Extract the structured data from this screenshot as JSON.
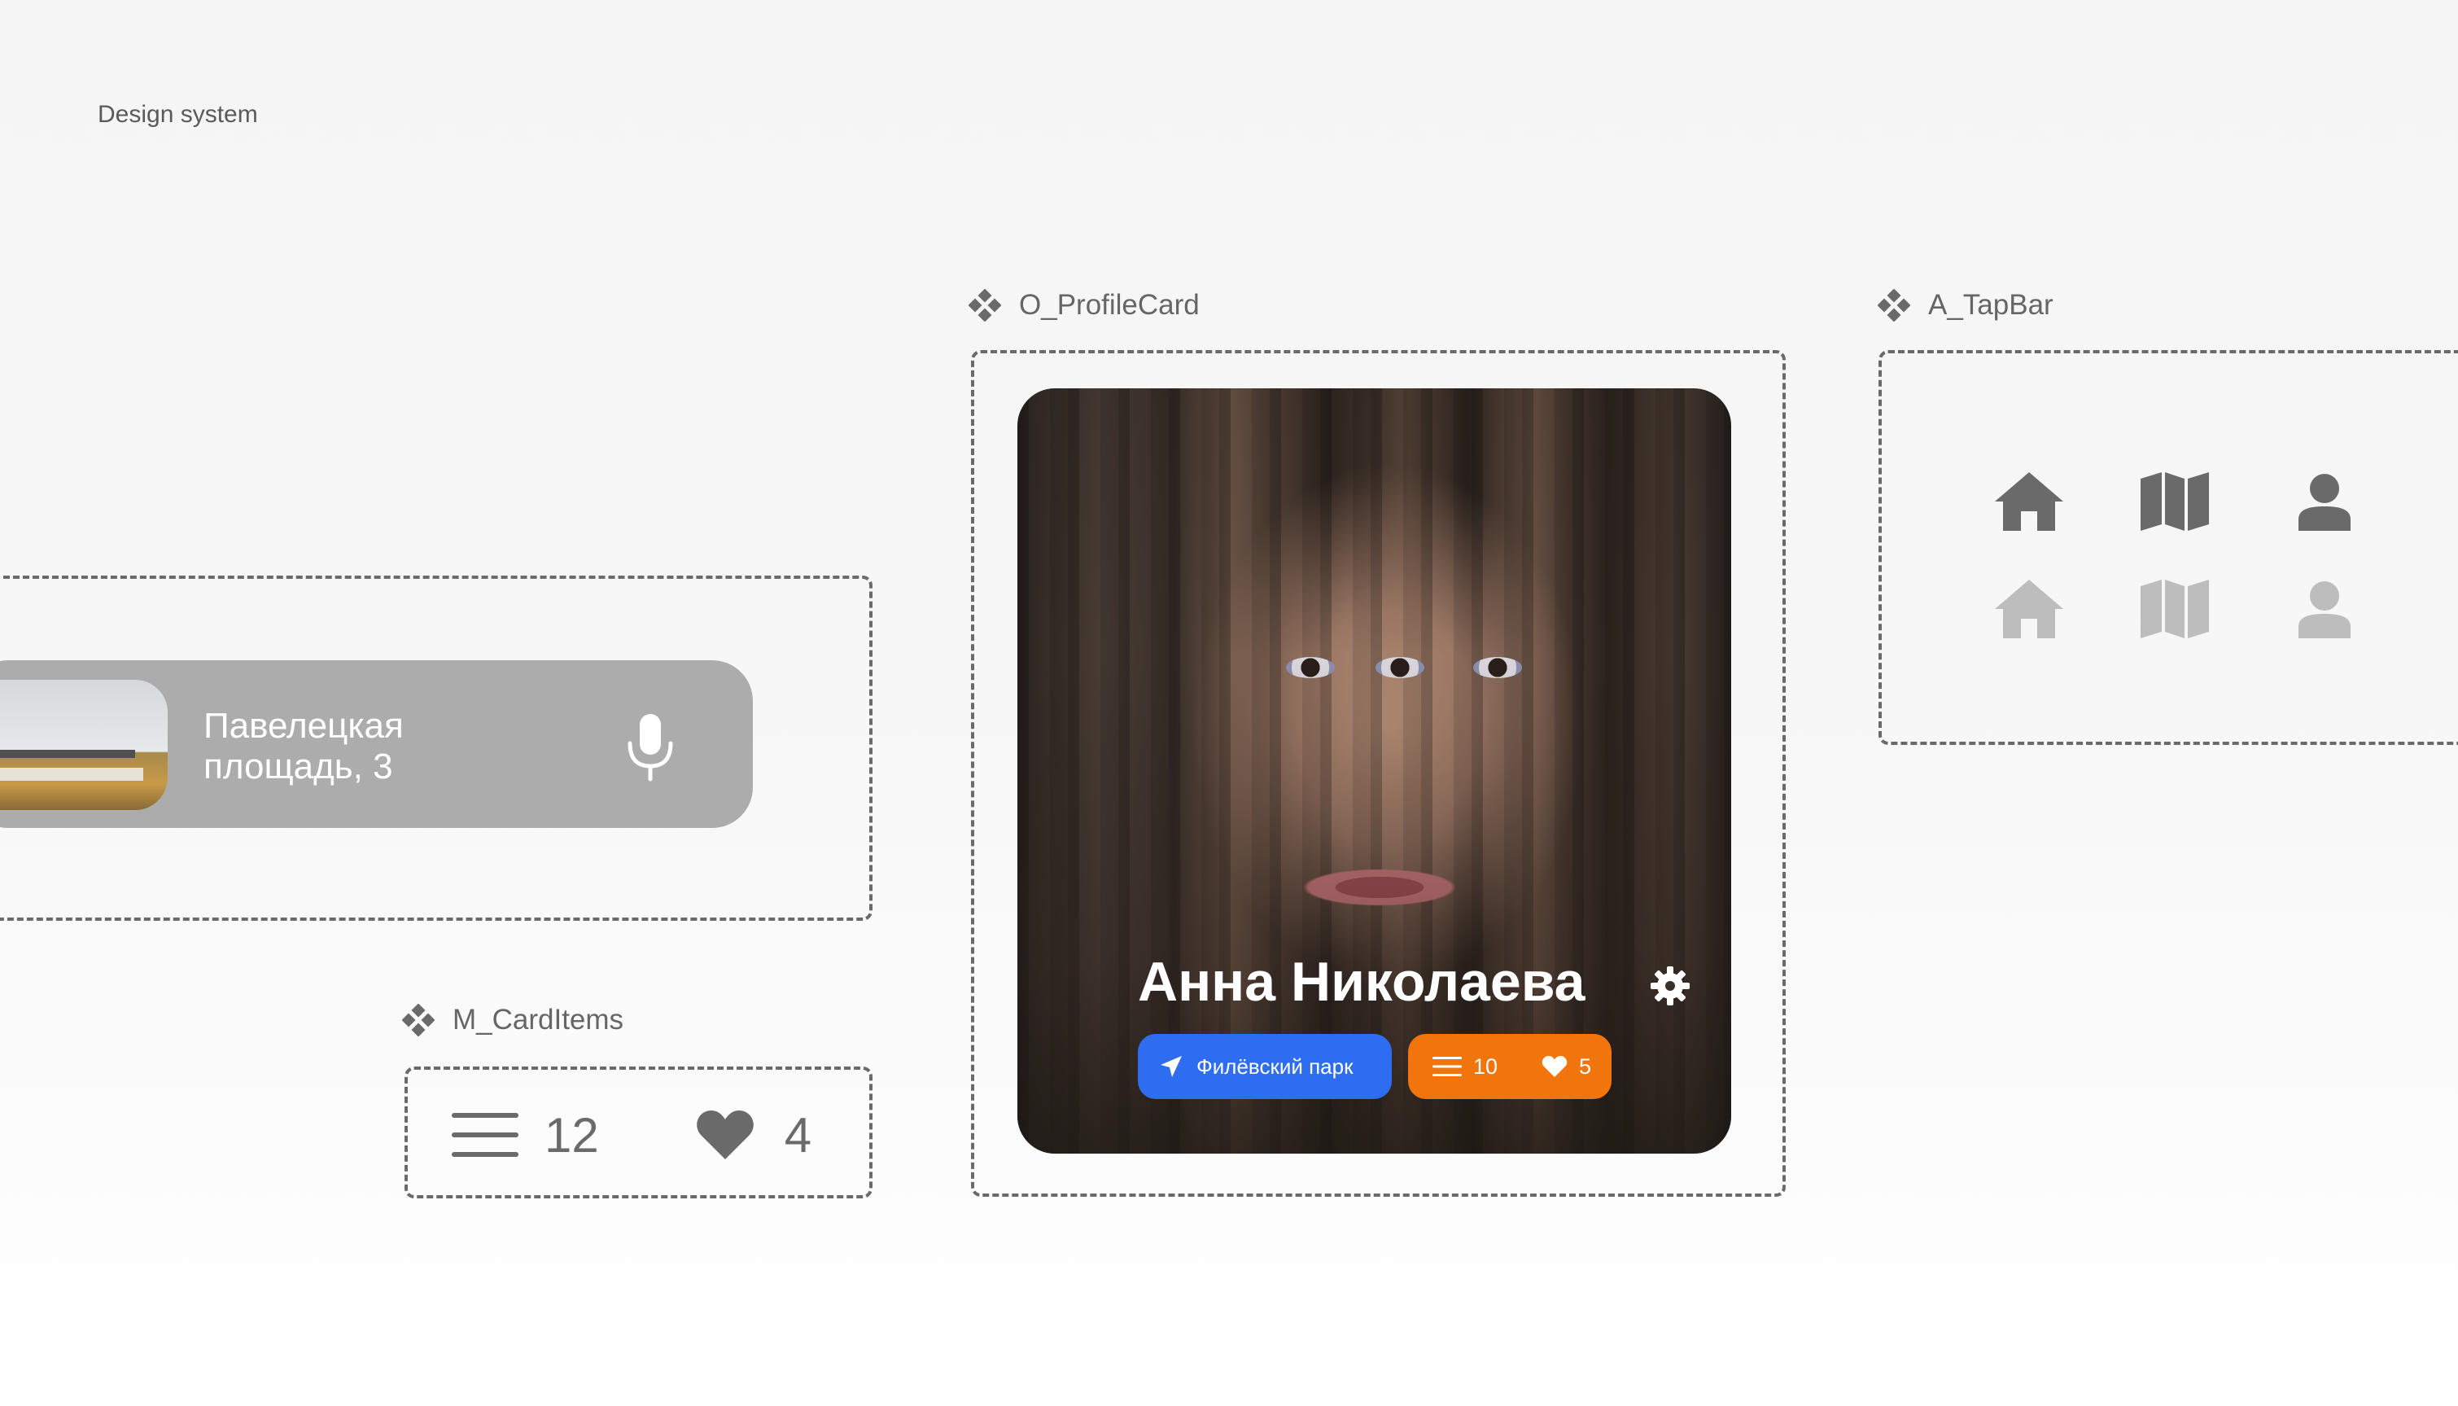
{
  "page": {
    "title": "Design system"
  },
  "components": {
    "profile_card_label": "O_ProfileCard",
    "tapbar_label": "A_TapBar",
    "carditems_label": "M_CardItems"
  },
  "search": {
    "address_line1": "Павелецкая",
    "address_line2": "площадь, 3",
    "pill_color": "#acacac"
  },
  "carditems": {
    "count": "12",
    "likes": "4"
  },
  "profile": {
    "name": "Анна Николаева",
    "location": "Филёвский парк",
    "items": "10",
    "likes": "5",
    "location_color": "#2f6df0",
    "stats_color": "#f2740c"
  },
  "tapbar": {
    "active_row": [
      "home-icon",
      "map-icon",
      "user-icon"
    ],
    "inactive_row": [
      "home-icon",
      "map-icon",
      "user-icon"
    ],
    "active_color": "#6a6a6a",
    "inactive_color": "#bdbdbd"
  }
}
